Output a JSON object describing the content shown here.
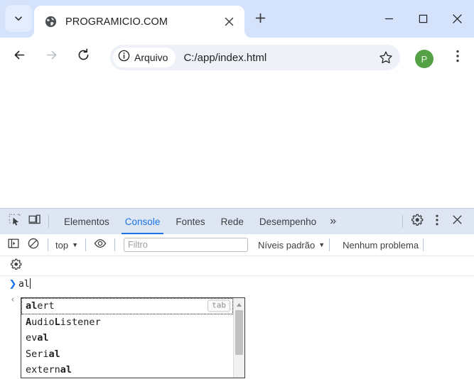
{
  "window": {
    "controls": {
      "minimize": "minimize-icon",
      "maximize": "maximize-icon",
      "close": "close-icon"
    }
  },
  "tabstrip": {
    "search_icon": "chevron-down-icon",
    "tabs": [
      {
        "title": "PROGRAMICIO.COM",
        "favicon": "globe-icon",
        "active": true
      }
    ],
    "new_tab_label": "+"
  },
  "toolbar": {
    "back_icon": "arrow-left-icon",
    "forward_icon": "arrow-right-icon",
    "reload_icon": "reload-icon",
    "security_chip": {
      "icon": "info-circle-icon",
      "label": "Arquivo"
    },
    "url": "C:/app/index.html",
    "bookmark_icon": "star-icon",
    "avatar_letter": "P",
    "avatar_color": "#54a245",
    "menu_icon": "kebab-menu-icon"
  },
  "devtools": {
    "inspect_icon": "inspect-element-icon",
    "device_icon": "device-toolbar-icon",
    "tabs": [
      {
        "label": "Elementos",
        "active": false
      },
      {
        "label": "Console",
        "active": true
      },
      {
        "label": "Fontes",
        "active": false
      },
      {
        "label": "Rede",
        "active": false
      },
      {
        "label": "Desempenho",
        "active": false
      }
    ],
    "more_tabs_label": "»",
    "settings_icon": "gear-icon",
    "overflow_icon": "kebab-menu-icon",
    "close_icon": "close-icon",
    "accent_color": "#1a73e8",
    "filterbar": {
      "sidebar_icon": "console-sidebar-icon",
      "clear_icon": "clear-console-icon",
      "context": "top",
      "context_caret": "▼",
      "eye_icon": "live-expression-icon",
      "filter_placeholder": "Filtro",
      "filter_value": "",
      "levels_label": "Níveis padrão",
      "levels_caret": "▼",
      "issues_label": "Nenhum problema"
    },
    "console_settings_icon": "gear-icon",
    "console": {
      "prompt_arrow": "❯",
      "prompt_text": "al",
      "response_arrow": "‹",
      "response_text": "",
      "autocomplete": {
        "tab_hint": "tab",
        "scroll_up_icon": "triangle-up-icon",
        "items": [
          {
            "prefix": "",
            "match": "al",
            "suffix": "ert",
            "selected": true
          },
          {
            "prefix": "",
            "match": "A",
            "suffix": "udio",
            "match2": "L",
            "suffix2": "istener",
            "selected": false
          },
          {
            "prefix": "ev",
            "match": "al",
            "suffix": "",
            "selected": false
          },
          {
            "prefix": "Seri",
            "match": "al",
            "suffix": "",
            "selected": false
          },
          {
            "prefix": "extern",
            "match": "al",
            "suffix": "",
            "selected": false
          }
        ]
      }
    }
  }
}
